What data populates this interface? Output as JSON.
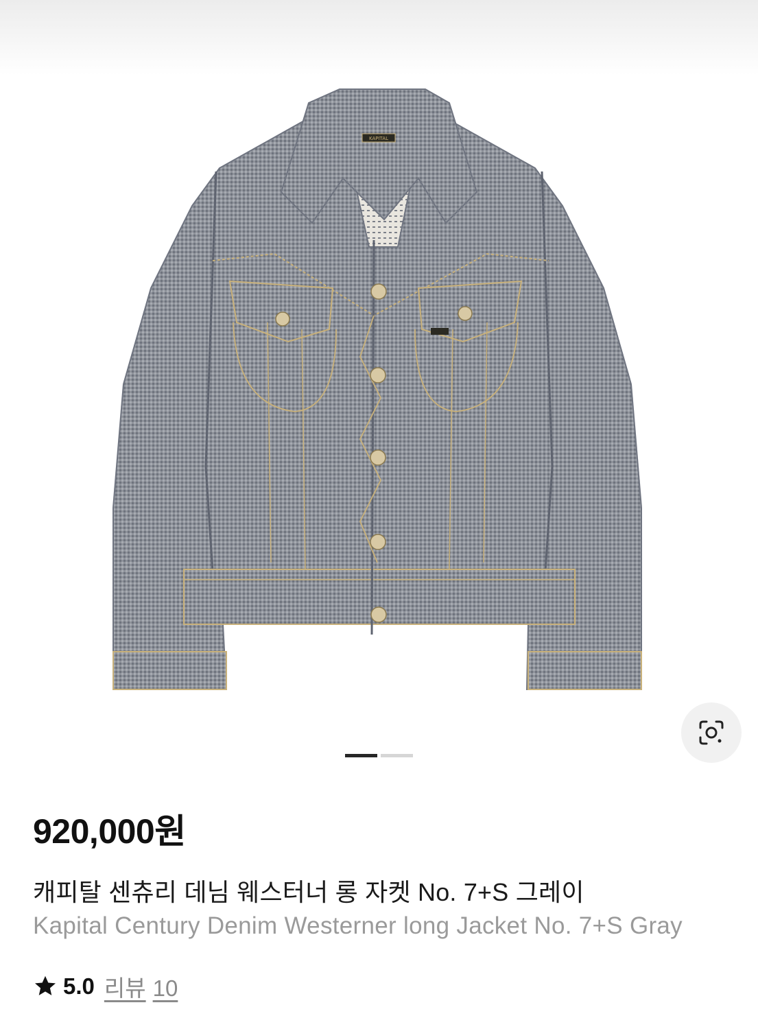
{
  "product": {
    "image_alt": "Kapital Century Denim Westerner long Jacket No. 7+S Gray",
    "image_label": "KAPITAL",
    "price": "920,000원",
    "title_ko": "캐피탈 센츄리 데님 웨스터너 롱 자켓 No. 7+S 그레이",
    "title_en": "Kapital Century Denim Westerner long Jacket No. 7+S Gray"
  },
  "gallery": {
    "current_index": 1,
    "total": 2
  },
  "rating": {
    "icon": "star-icon",
    "value": "5.0",
    "review_label": "리뷰",
    "review_count": "10"
  },
  "lens": {
    "icon": "image-search-icon"
  },
  "colors": {
    "denim": "#8a8e96",
    "stitch": "#c9b17a",
    "price_text": "#111111",
    "secondary_text": "#9a9a9a",
    "pager_active": "#262626",
    "pager_inactive": "#d6d6d6"
  }
}
